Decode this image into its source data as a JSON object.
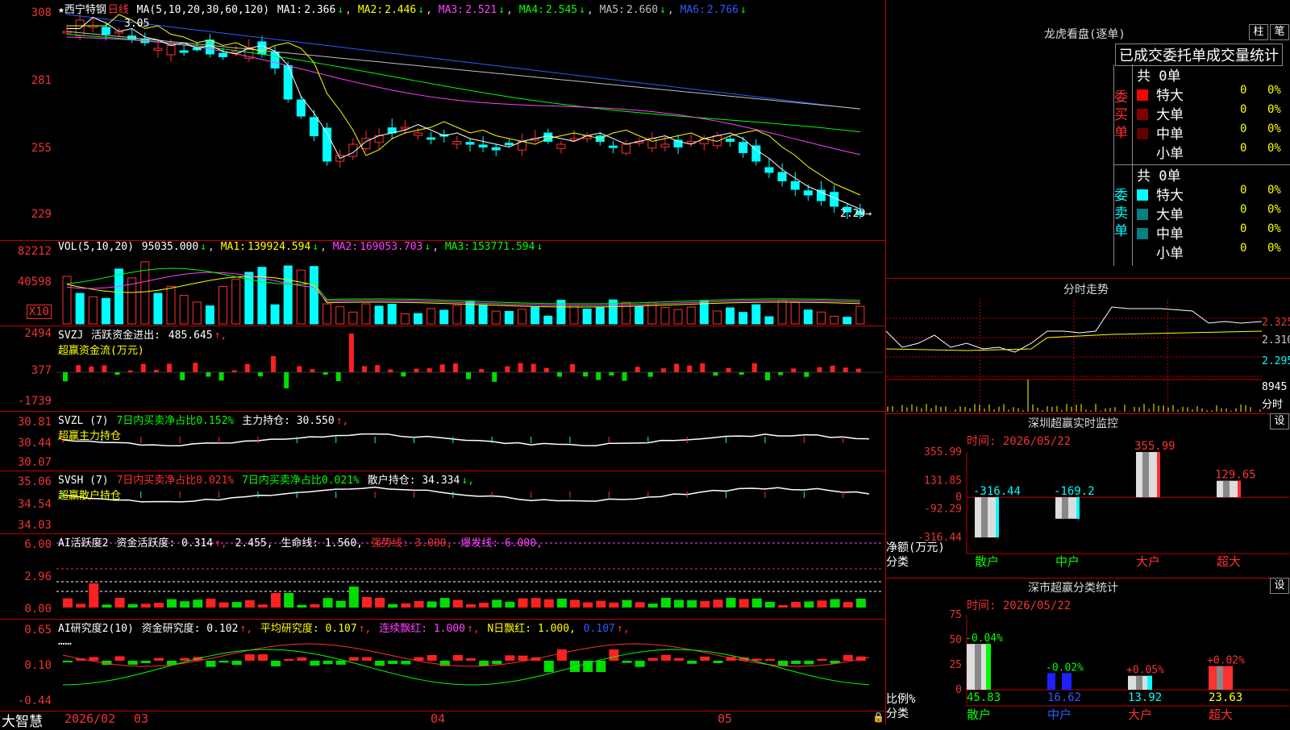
{
  "colors": {
    "up": "#ff3030",
    "down": "#00ffff",
    "bg": "#000000",
    "grid": "#c00000",
    "ma1": "#ffffff",
    "ma2": "#ffff00",
    "ma3": "#ff40ff",
    "ma4": "#00ff00",
    "ma5": "#c0c0c0",
    "ma6": "#2d5bff"
  },
  "kline": {
    "stock_name": "★西宁特钢",
    "period": "日线",
    "ma_label": "MA(5,10,20,30,60,120)",
    "ma": [
      {
        "label": "MA1:",
        "value": "2.366",
        "arrow": "↓"
      },
      {
        "label": "MA2:",
        "value": "2.446",
        "arrow": "↓"
      },
      {
        "label": "MA3:",
        "value": "2.521",
        "arrow": "↓"
      },
      {
        "label": "MA4:",
        "value": "2.545",
        "arrow": "↓"
      },
      {
        "label": "MA5:",
        "value": "2.660",
        "arrow": "↓"
      },
      {
        "label": "MA6:",
        "value": "2.766",
        "arrow": "↓"
      }
    ],
    "y_ticks": [
      "308",
      "281",
      "255",
      "229"
    ],
    "high_mark": "3.05",
    "low_mark": "2.29→"
  },
  "volume": {
    "label": "VOL(5,10,20)",
    "value": "95035.000",
    "value_arrow": "↓",
    "ma": [
      {
        "label": "MA1:",
        "value": "139924.594",
        "arrow": "↓"
      },
      {
        "label": "MA2:",
        "value": "169053.703",
        "arrow": "↓"
      },
      {
        "label": "MA3:",
        "value": "153771.594",
        "arrow": "↓"
      }
    ],
    "y_ticks": [
      "82212",
      "40598"
    ],
    "unit": "X10"
  },
  "svzj": {
    "label": "SVZJ",
    "name": "活跃资金进出:",
    "value": "485.645",
    "arrow": "↑,",
    "subtitle": "超赢资金流(万元)",
    "y_ticks": [
      "2494",
      "377",
      "-1739"
    ]
  },
  "svzl": {
    "label": "SVZL (7)",
    "item1": "7日内买卖净占比0.152%",
    "item2": "主力持仓: 30.550",
    "arrow": "↑,",
    "subtitle": "超赢主力持仓",
    "y_ticks": [
      "30.81",
      "30.44",
      "30.07"
    ]
  },
  "svsh": {
    "label": "SVSH (7)",
    "item1": "7日内买卖净占比0.021%",
    "item2": "7日内买卖净占比0.021%",
    "item3": "散户持仓: 34.334",
    "arrow": "↓,",
    "subtitle": "超赢散户持仓",
    "y_ticks": [
      "35.06",
      "34.54",
      "34.03"
    ]
  },
  "ai_active": {
    "label": "AI活跃度2",
    "item1": "资金活跃度: 0.314",
    "item1_arrow": "↑,",
    "item2": "2.455,",
    "item3": "生命线: 1.560,",
    "item4": "强势线: 3.000,",
    "item5": "爆发线: 6.000,",
    "y_ticks": [
      "6.00",
      "2.96",
      "0.00"
    ]
  },
  "ai_research": {
    "label": "AI研究度2(10)",
    "item1": "资金研究度: 0.102",
    "item1_arrow": "↑,",
    "item2": "平均研究度: 0.107",
    "item2_arrow": "↑,",
    "item3": "连续飘红: 1.000",
    "item3_arrow": "↑,",
    "item4": "N日飘红: 1.000,",
    "item5": "0.107",
    "item5_arrow": "↑,",
    "comment": "……",
    "y_ticks": [
      "0.65",
      "0.10",
      "-0.44"
    ]
  },
  "dates": {
    "d1": "2026/02",
    "d2": "03",
    "d3": "04",
    "d4": "05"
  },
  "brand": "大智慧",
  "right": {
    "longhu_title": "龙虎看盘(逐单)",
    "btn_zhu": "柱",
    "btn_bi": "笔",
    "stat_title": "已成交委托单成交量统计",
    "buy_side": "委买单",
    "sell_side": "委卖单",
    "buy_total": "共 0单",
    "sell_total": "共 0单",
    "buy_rows": [
      {
        "name": "特大",
        "val": "0",
        "pct": "0%",
        "color": "#ff0000"
      },
      {
        "name": "大单",
        "val": "0",
        "pct": "0%",
        "color": "#800000"
      },
      {
        "name": "中单",
        "val": "0",
        "pct": "0%",
        "color": "#600000"
      },
      {
        "name": "小单",
        "val": "0",
        "pct": "0%",
        "color": ""
      }
    ],
    "sell_rows": [
      {
        "name": "特大",
        "val": "0",
        "pct": "0%",
        "color": "#00ffff"
      },
      {
        "name": "大单",
        "val": "0",
        "pct": "0%",
        "color": "#008080"
      },
      {
        "name": "中单",
        "val": "0",
        "pct": "0%",
        "color": "#008080"
      },
      {
        "name": "小单",
        "val": "0",
        "pct": "0%",
        "color": ""
      }
    ],
    "intraday_title": "分时走势",
    "intraday_ticks": [
      "2.325",
      "2.310",
      "2.295"
    ],
    "intraday_vol": "8945",
    "intraday_unit": "分时",
    "monitor_title": "深圳超赢实时监控",
    "monitor_btn": "设",
    "monitor_time": "时间: 2026/05/22",
    "monitor_ticks": [
      "355.99",
      "131.85",
      "0",
      "-92.29",
      "-316.44"
    ],
    "monitor_ylabel": "净额(万元)",
    "monitor_xlabel": "分类",
    "classify_title": "深市超赢分类统计",
    "classify_btn": "设",
    "classify_time": "时间: 2026/05/22",
    "classify_ticks": [
      "75",
      "50",
      "25",
      "0"
    ],
    "classify_ylabel": "比例%",
    "classify_xlabel": "分类"
  },
  "chart_data": [
    {
      "type": "bar",
      "title": "深圳超赢实时监控",
      "ylabel": "净额(万元)",
      "xlabel": "分类",
      "categories": [
        "散户",
        "中户",
        "大户",
        "超大"
      ],
      "values": [
        -316.44,
        -169.2,
        355.99,
        129.65
      ],
      "value_labels": [
        "-316.44",
        "-169.2",
        "355.99",
        "129.65"
      ],
      "ylim": [
        -316.44,
        355.99
      ]
    },
    {
      "type": "bar",
      "title": "深市超赢分类统计",
      "ylabel": "比例%",
      "xlabel": "分类",
      "categories": [
        "散户",
        "中户",
        "大户",
        "超大"
      ],
      "values": [
        45.83,
        16.62,
        13.92,
        23.63
      ],
      "value_labels": [
        "45.83",
        "16.62",
        "13.92",
        "23.63"
      ],
      "change_labels": [
        "-0.04%",
        "-0.02%",
        "+0.05%",
        "+0.02%"
      ],
      "ylim": [
        0,
        75
      ]
    }
  ]
}
